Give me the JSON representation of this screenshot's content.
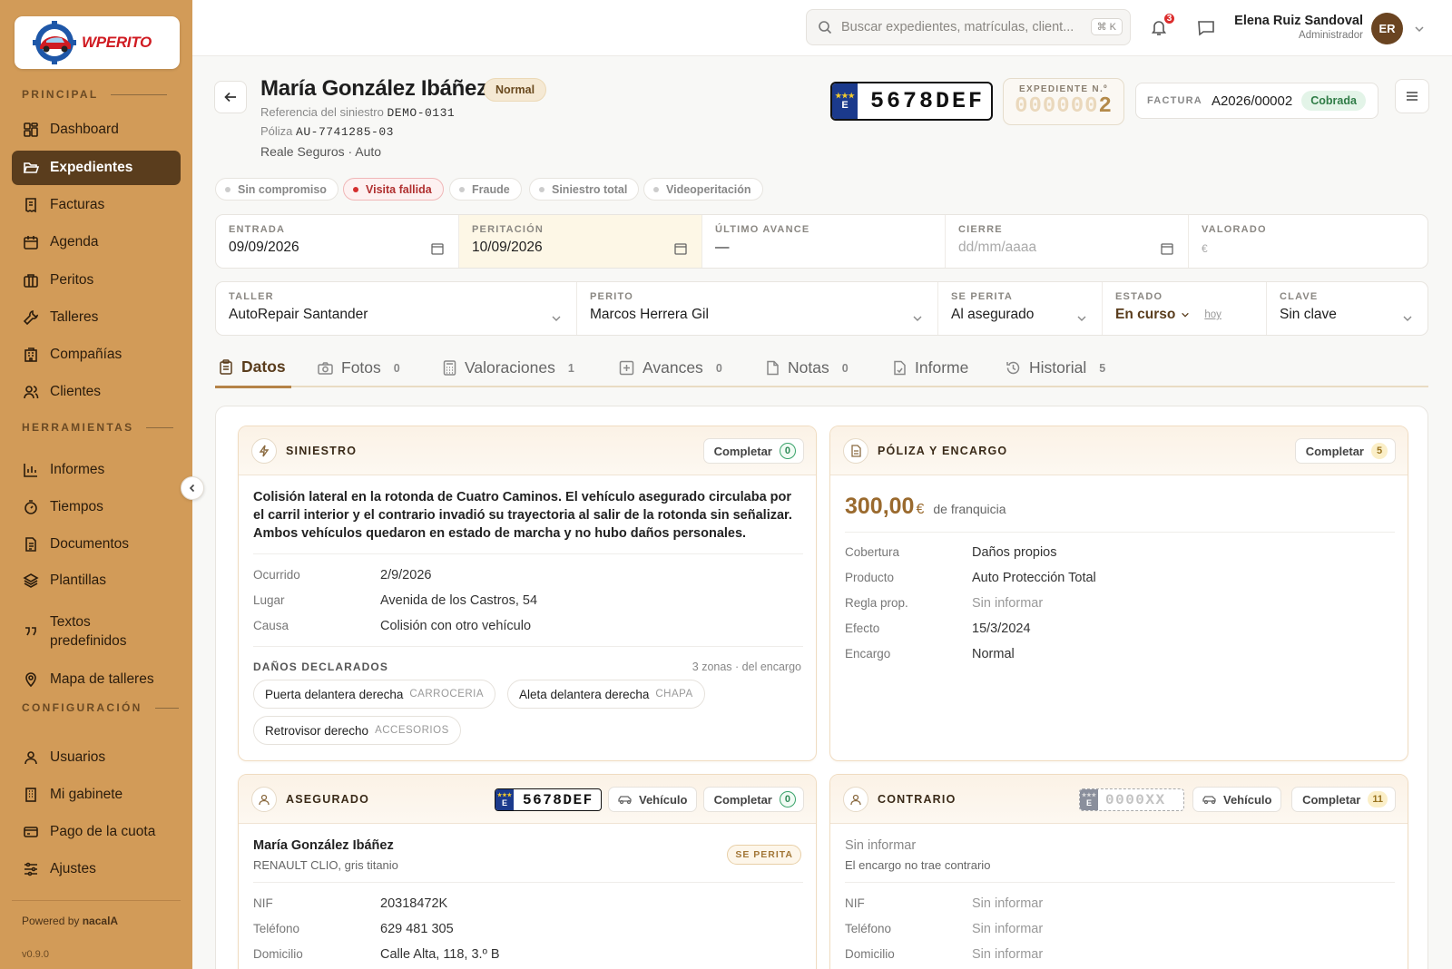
{
  "brand": {
    "name": "WPERITO",
    "powered_prefix": "Powered by",
    "powered_name": "nacalA",
    "version": "v0.9.0"
  },
  "sidebar": {
    "sections": {
      "principal": "PRINCIPAL",
      "herramientas": "HERRAMIENTAS",
      "configuracion": "CONFIGURACIÓN"
    },
    "items": [
      {
        "label": "Dashboard",
        "icon": "dashboard-icon"
      },
      {
        "label": "Expedientes",
        "icon": "folder-open-icon",
        "active": true
      },
      {
        "label": "Facturas",
        "icon": "receipt-icon"
      },
      {
        "label": "Agenda",
        "icon": "calendar-icon"
      },
      {
        "label": "Peritos",
        "icon": "briefcase-icon"
      },
      {
        "label": "Talleres",
        "icon": "wrench-icon"
      },
      {
        "label": "Compañías",
        "icon": "building-icon"
      },
      {
        "label": "Clientes",
        "icon": "users-icon"
      },
      {
        "label": "Informes",
        "icon": "bar-chart-icon"
      },
      {
        "label": "Tiempos",
        "icon": "timer-icon"
      },
      {
        "label": "Documentos",
        "icon": "document-icon"
      },
      {
        "label": "Plantillas",
        "icon": "layers-icon"
      },
      {
        "label": "Textos predefinidos",
        "icon": "quote-icon"
      },
      {
        "label": "Mapa de talleres",
        "icon": "map-pin-icon"
      },
      {
        "label": "Usuarios",
        "icon": "user-icon"
      },
      {
        "label": "Mi gabinete",
        "icon": "office-icon"
      },
      {
        "label": "Pago de la cuota",
        "icon": "credit-card-icon"
      },
      {
        "label": "Ajustes",
        "icon": "sliders-icon"
      }
    ]
  },
  "topbar": {
    "search_placeholder": "Buscar expedientes, matrículas, client...",
    "shortcut": "⌘ K",
    "notifications": "3",
    "user_name": "Elena Ruiz Sandoval",
    "user_role": "Administrador",
    "initials": "ER"
  },
  "case": {
    "name": "María González Ibáñez",
    "priority": "Normal",
    "ref_label": "Referencia del siniestro",
    "ref_value": "DEMO-0131",
    "policy_label": "Póliza",
    "policy_value": "AU-7741285-03",
    "company": "Reale Seguros · Auto",
    "plate": "5678DEF",
    "plate_country": "E",
    "expediente_label": "EXPEDIENTE N.º",
    "expediente_faded": "000000",
    "expediente_digit": "2",
    "factura_label": "FACTURA",
    "factura_value": "A2026/00002",
    "factura_status": "Cobrada"
  },
  "flags": [
    "Sin compromiso",
    "Visita fallida",
    "Fraude",
    "Siniestro total",
    "Videoperitación"
  ],
  "dates": [
    {
      "label": "ENTRADA",
      "value": "09/09/2026"
    },
    {
      "label": "PERITACIÓN",
      "value": "10/09/2026"
    },
    {
      "label": "ÚLTIMO AVANCE",
      "value": "—"
    },
    {
      "label": "CIERRE",
      "value": "dd/mm/aaaa"
    },
    {
      "label": "VALORADO",
      "value": "€"
    }
  ],
  "assign": [
    {
      "label": "TALLER",
      "value": "AutoRepair Santander"
    },
    {
      "label": "PERITO",
      "value": "Marcos Herrera Gil"
    },
    {
      "label": "SE PERITA",
      "value": "Al asegurado"
    },
    {
      "label": "ESTADO",
      "value": "En curso",
      "extra": "hoy"
    },
    {
      "label": "CLAVE",
      "value": "Sin clave"
    }
  ],
  "tabs": [
    {
      "label": "Datos",
      "count": ""
    },
    {
      "label": "Fotos",
      "count": "0"
    },
    {
      "label": "Valoraciones",
      "count": "1"
    },
    {
      "label": "Avances",
      "count": "0"
    },
    {
      "label": "Notas",
      "count": "0"
    },
    {
      "label": "Informe",
      "count": ""
    },
    {
      "label": "Historial",
      "count": "5"
    }
  ],
  "siniestro": {
    "title": "SINIESTRO",
    "complete": "Completar",
    "complete_count": "0",
    "description": "Colisión lateral en la rotonda de Cuatro Caminos. El vehículo asegurado circulaba por el carril interior y el contrario invadió su trayectoria al salir de la rotonda sin señalizar. Ambos vehículos quedaron en estado de marcha y no hubo daños personales.",
    "fields": [
      {
        "k": "Ocurrido",
        "v": "2/9/2026"
      },
      {
        "k": "Lugar",
        "v": "Avenida de los Castros, 54"
      },
      {
        "k": "Causa",
        "v": "Colisión con otro vehículo"
      }
    ],
    "damages_title": "DAÑOS DECLARADOS",
    "damages_summary": "3 zonas · del encargo",
    "damages": [
      {
        "name": "Puerta delantera derecha",
        "cat": "CARROCERIA"
      },
      {
        "name": "Aleta delantera derecha",
        "cat": "CHAPA"
      },
      {
        "name": "Retrovisor derecho",
        "cat": "ACCESORIOS"
      }
    ]
  },
  "poliza": {
    "title": "PÓLIZA Y ENCARGO",
    "complete": "Completar",
    "complete_count": "5",
    "amount": "300,00",
    "currency": "€",
    "amount_suffix": "de franquicia",
    "fields": [
      {
        "k": "Cobertura",
        "v": "Daños propios"
      },
      {
        "k": "Producto",
        "v": "Auto Protección Total"
      },
      {
        "k": "Regla prop.",
        "v": "Sin informar",
        "ph": true
      },
      {
        "k": "Efecto",
        "v": "15/3/2024"
      },
      {
        "k": "Encargo",
        "v": "Normal"
      }
    ]
  },
  "asegurado": {
    "title": "ASEGURADO",
    "plate": "5678DEF",
    "plate_country": "E",
    "vehicle_btn": "Vehículo",
    "complete": "Completar",
    "complete_count": "0",
    "name": "María González Ibáñez",
    "vehicle": "RENAULT CLIO, gris titanio",
    "badge": "SE PERITA",
    "fields": [
      {
        "k": "NIF",
        "v": "20318472K"
      },
      {
        "k": "Teléfono",
        "v": "629 481 305"
      },
      {
        "k": "Domicilio",
        "v": "Calle Alta, 118, 3.º B"
      }
    ]
  },
  "contrario": {
    "title": "CONTRARIO",
    "plate": "0000XX",
    "plate_country": "E",
    "vehicle_btn": "Vehículo",
    "complete": "Completar",
    "complete_count": "11",
    "name": "Sin informar",
    "note": "El encargo no trae contrario",
    "fields": [
      {
        "k": "NIF",
        "v": "Sin informar"
      },
      {
        "k": "Teléfono",
        "v": "Sin informar"
      },
      {
        "k": "Domicilio",
        "v": "Sin informar"
      }
    ]
  },
  "colors": {
    "sidebar": "#d29b58",
    "active": "#5a3d1d",
    "accent": "#b58347",
    "danger": "#d42d2d",
    "success": "#2f7c46"
  }
}
